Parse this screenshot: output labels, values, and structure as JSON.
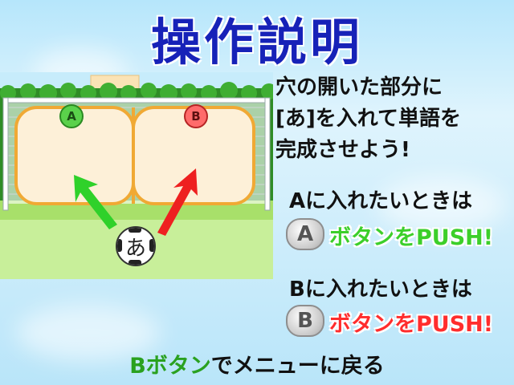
{
  "title": "操作説明",
  "instructions": [
    "穴の開いた部分に",
    "[あ]を入れて単語を",
    "完成させよう!"
  ],
  "scene": {
    "target_a": "A",
    "target_b": "B",
    "ball_char": "あ"
  },
  "row_a": {
    "label": "Aに入れたいときは",
    "button": "A",
    "action": "ボタンをPUSH!",
    "action_color": "#3ccf2a"
  },
  "row_b": {
    "label": "Bに入れたいときは",
    "button": "B",
    "action": "ボタンをPUSH!",
    "action_color": "#ff2d2d"
  },
  "footer": {
    "button": "Bボタン",
    "text": "でメニューに戻る"
  },
  "colors": {
    "title": "#1722b8",
    "green": "#2aa11f",
    "red": "#e42a2a"
  }
}
